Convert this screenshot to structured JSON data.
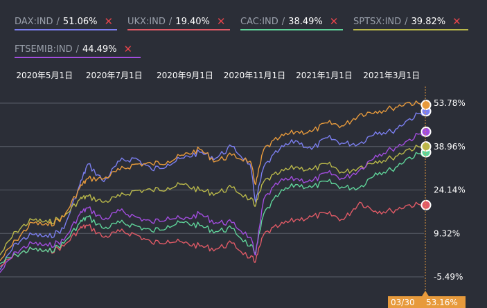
{
  "legend_separator": "/",
  "remove_glyph": "✕",
  "colors": {
    "background": "#2b2e37",
    "grid": "#5a5e69",
    "tick_text": "#ffffff",
    "cursor": "#e79a3c",
    "badge_bg": "#e79a3c"
  },
  "cursor": {
    "date_label": "03/30",
    "value_label": "53.16%"
  },
  "chart_data": {
    "type": "line",
    "title": "",
    "xlabel": "",
    "ylabel": "",
    "x_range": [
      "2020-03-23",
      "2021-03-30"
    ],
    "x_ticks": [
      {
        "date": "2020-05-01",
        "label": "2020年5月1日"
      },
      {
        "date": "2020-07-01",
        "label": "2020年7月1日"
      },
      {
        "date": "2020-09-01",
        "label": "2020年9月1日"
      },
      {
        "date": "2020-11-01",
        "label": "2020年11月1日"
      },
      {
        "date": "2021-01-01",
        "label": "2021年1月1日"
      },
      {
        "date": "2021-03-01",
        "label": "2021年3月1日"
      }
    ],
    "y_ticks": [
      53.78,
      38.96,
      24.14,
      9.32,
      -5.49
    ],
    "y_tick_labels": [
      "53.78%",
      "38.96%",
      "24.14%",
      "9.32%",
      "-5.49%"
    ],
    "ylim": [
      -7,
      61
    ],
    "grid": true,
    "series": [
      {
        "name": "DAX:IND",
        "change": "51.06%",
        "color": "#7b7ff0",
        "x": [
          "2020-03-23",
          "2020-04-06",
          "2020-04-20",
          "2020-05-04",
          "2020-05-18",
          "2020-06-01",
          "2020-06-08",
          "2020-06-22",
          "2020-07-06",
          "2020-07-20",
          "2020-08-03",
          "2020-08-17",
          "2020-08-31",
          "2020-09-14",
          "2020-09-28",
          "2020-10-12",
          "2020-10-28",
          "2020-11-02",
          "2020-11-09",
          "2020-11-23",
          "2020-12-07",
          "2020-12-21",
          "2021-01-04",
          "2021-01-18",
          "2021-02-01",
          "2021-02-15",
          "2021-03-01",
          "2021-03-15",
          "2021-03-30"
        ],
        "y": [
          -3,
          6,
          9,
          8,
          11,
          26,
          33,
          27,
          34,
          35,
          31,
          33,
          35,
          37,
          35,
          39,
          33,
          20,
          32,
          38,
          41,
          38,
          42,
          40,
          40,
          44,
          44,
          48,
          51
        ]
      },
      {
        "name": "UKX:IND",
        "change": "19.40%",
        "color": "#e05a66",
        "x": [
          "2020-03-23",
          "2020-04-06",
          "2020-04-20",
          "2020-05-04",
          "2020-05-18",
          "2020-06-01",
          "2020-06-08",
          "2020-06-22",
          "2020-07-06",
          "2020-07-20",
          "2020-08-03",
          "2020-08-17",
          "2020-08-31",
          "2020-09-14",
          "2020-09-28",
          "2020-10-12",
          "2020-10-28",
          "2020-11-02",
          "2020-11-09",
          "2020-11-23",
          "2020-12-07",
          "2020-12-21",
          "2021-01-04",
          "2021-01-18",
          "2021-02-01",
          "2021-02-15",
          "2021-03-01",
          "2021-03-15",
          "2021-03-30"
        ],
        "y": [
          -2,
          2,
          4,
          3,
          5,
          11,
          12,
          8,
          10,
          9,
          6,
          7,
          6,
          5,
          4,
          6,
          1,
          0,
          9,
          12,
          14,
          15,
          16,
          14,
          20,
          17,
          17,
          19,
          19
        ]
      },
      {
        "name": "CAC:IND",
        "change": "38.49%",
        "color": "#5fd49a",
        "x": [
          "2020-03-23",
          "2020-04-06",
          "2020-04-20",
          "2020-05-04",
          "2020-05-18",
          "2020-06-01",
          "2020-06-08",
          "2020-06-22",
          "2020-07-06",
          "2020-07-20",
          "2020-08-03",
          "2020-08-17",
          "2020-08-31",
          "2020-09-14",
          "2020-09-28",
          "2020-10-12",
          "2020-10-28",
          "2020-11-02",
          "2020-11-09",
          "2020-11-23",
          "2020-12-07",
          "2020-12-21",
          "2021-01-04",
          "2021-01-18",
          "2021-02-01",
          "2021-02-15",
          "2021-03-01",
          "2021-03-15",
          "2021-03-30"
        ],
        "y": [
          -1,
          2,
          4,
          3,
          6,
          13,
          15,
          11,
          13,
          12,
          10,
          12,
          13,
          12,
          10,
          11,
          5,
          3,
          16,
          23,
          26,
          25,
          27,
          25,
          25,
          30,
          31,
          35,
          37
        ]
      },
      {
        "name": "SPTSX:IND",
        "change": "39.82%",
        "color": "#b9b84a",
        "x": [
          "2020-03-23",
          "2020-04-06",
          "2020-04-20",
          "2020-05-04",
          "2020-05-18",
          "2020-06-01",
          "2020-06-08",
          "2020-06-22",
          "2020-07-06",
          "2020-07-20",
          "2020-08-03",
          "2020-08-17",
          "2020-08-31",
          "2020-09-14",
          "2020-09-28",
          "2020-10-12",
          "2020-10-28",
          "2020-11-02",
          "2020-11-09",
          "2020-11-23",
          "2020-12-07",
          "2020-12-21",
          "2021-01-04",
          "2021-01-18",
          "2021-02-01",
          "2021-02-15",
          "2021-03-01",
          "2021-03-15",
          "2021-03-30"
        ],
        "y": [
          2,
          10,
          14,
          13,
          15,
          21,
          22,
          20,
          22,
          24,
          24,
          25,
          26,
          24,
          23,
          25,
          21,
          19,
          27,
          30,
          32,
          31,
          33,
          30,
          32,
          34,
          35,
          38,
          39
        ]
      },
      {
        "name": "FTSEMIB:IND",
        "change": "44.49%",
        "color": "#a24ddf",
        "x": [
          "2020-03-23",
          "2020-04-06",
          "2020-04-20",
          "2020-05-04",
          "2020-05-18",
          "2020-06-01",
          "2020-06-08",
          "2020-06-22",
          "2020-07-06",
          "2020-07-20",
          "2020-08-03",
          "2020-08-17",
          "2020-08-31",
          "2020-09-14",
          "2020-09-28",
          "2020-10-12",
          "2020-10-28",
          "2020-11-02",
          "2020-11-09",
          "2020-11-23",
          "2020-12-07",
          "2020-12-21",
          "2021-01-04",
          "2021-01-18",
          "2021-02-01",
          "2021-02-15",
          "2021-03-01",
          "2021-03-15",
          "2021-03-30"
        ],
        "y": [
          -4,
          3,
          6,
          5,
          7,
          16,
          18,
          14,
          17,
          15,
          13,
          15,
          14,
          16,
          13,
          13,
          8,
          2,
          21,
          27,
          28,
          27,
          30,
          28,
          31,
          36,
          38,
          41,
          44
        ]
      },
      {
        "name": "",
        "change": "",
        "color": "#e79a3c",
        "x": [
          "2020-03-23",
          "2020-04-06",
          "2020-04-20",
          "2020-05-04",
          "2020-05-18",
          "2020-06-01",
          "2020-06-08",
          "2020-06-22",
          "2020-07-06",
          "2020-07-20",
          "2020-08-03",
          "2020-08-17",
          "2020-08-31",
          "2020-09-14",
          "2020-09-28",
          "2020-10-12",
          "2020-10-28",
          "2020-11-02",
          "2020-11-09",
          "2020-11-23",
          "2020-12-07",
          "2020-12-21",
          "2021-01-04",
          "2021-01-18",
          "2021-02-01",
          "2021-02-15",
          "2021-03-01",
          "2021-03-15",
          "2021-03-30"
        ],
        "y": [
          0,
          7,
          13,
          12,
          15,
          25,
          28,
          28,
          31,
          33,
          33,
          34,
          36,
          38,
          34,
          36,
          34,
          26,
          38,
          42,
          44,
          44,
          47,
          46,
          50,
          51,
          52,
          54,
          53.16
        ]
      }
    ]
  }
}
